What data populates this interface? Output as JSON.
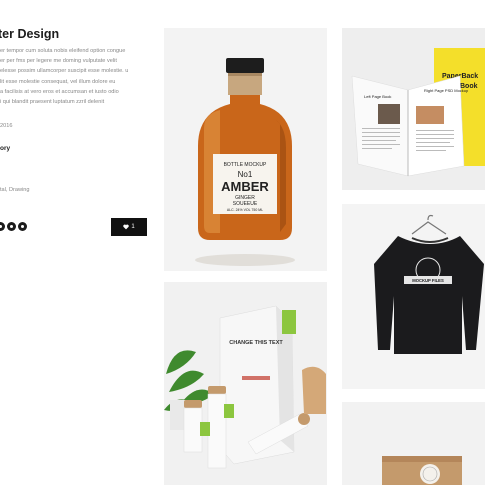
{
  "project": {
    "title": "ter Design",
    "description_lines": [
      "er tempor cum soluta nobis eleifend option congue",
      "er per fms per legere me doming vulputate velit",
      "elesse possim ullamcorper suscipit esse molestie. u",
      "lit esse molestie consequat, vel illum dolore eu",
      "a facilisis at vero eros et accumsan et iusto odio",
      "i qui blandit praesent luptatum zzril delenit"
    ],
    "date": "2016",
    "category": "ory",
    "tags": "tal, Drawing",
    "like_label": "1",
    "like_icon": "heart-icon"
  },
  "gallery": {
    "amber_bottle": {
      "label_top": "BOTTLE MOCKUP",
      "label_no": "No1",
      "label_main": "AMBER",
      "label_sub1": "GINGER",
      "label_sub2": "SOUEEUE",
      "label_foot": "ALC. 24% VOL  750 ML"
    },
    "magazine": {
      "left_page_title": "Left Page Book",
      "right_page_title": "Right Page PSD Mockup",
      "cover_text_1": "PaperBack",
      "cover_text_2": "Book"
    },
    "packaging": {
      "bag_text": "CHANGE THIS TEXT"
    },
    "sweatshirt": {
      "print_text": "MOCKUP FILES"
    }
  },
  "colors": {
    "amber": "#c9661a",
    "magazine_cover": "#f4df2a",
    "sweatshirt": "#1b1b1d",
    "accent_green": "#8cc63f",
    "kraft": "#c49a6c",
    "dark": "#111111"
  }
}
